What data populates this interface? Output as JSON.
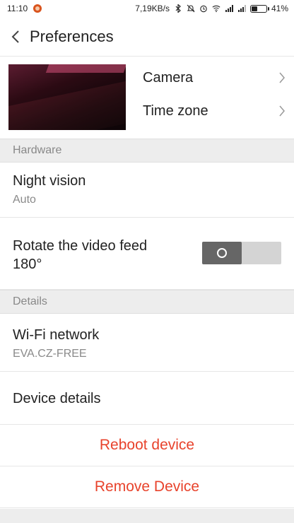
{
  "status_bar": {
    "time": "11:10",
    "network_speed": "7,19KB/s",
    "battery_percent": "41%",
    "battery_level": 0.41,
    "icons": [
      "app-notification-icon",
      "bluetooth-icon",
      "mute-icon",
      "alarm-icon",
      "wifi-icon",
      "signal-icon",
      "signal-icon",
      "battery-icon"
    ]
  },
  "header": {
    "title": "Preferences",
    "back_icon": "chevron-left-icon"
  },
  "top_menu": {
    "items": [
      {
        "label": "Camera",
        "icon": "chevron-right-icon"
      },
      {
        "label": "Time zone",
        "icon": "chevron-right-icon"
      }
    ]
  },
  "sections": {
    "hardware": "Hardware",
    "details": "Details"
  },
  "hardware": {
    "night_vision": {
      "title": "Night vision",
      "value": "Auto"
    },
    "rotate": {
      "title_line1": "Rotate the video feed",
      "title_line2": "180°",
      "toggle_on": false
    }
  },
  "details": {
    "wifi": {
      "title": "Wi-Fi network",
      "value": "EVA.CZ-FREE"
    },
    "device_details": {
      "title": "Device details"
    }
  },
  "actions": {
    "reboot": "Reboot device",
    "remove": "Remove Device"
  },
  "colors": {
    "accent_red": "#e8432c",
    "section_bg": "#ededed",
    "toggle_knob": "#666666",
    "toggle_track": "#d4d4d4"
  }
}
